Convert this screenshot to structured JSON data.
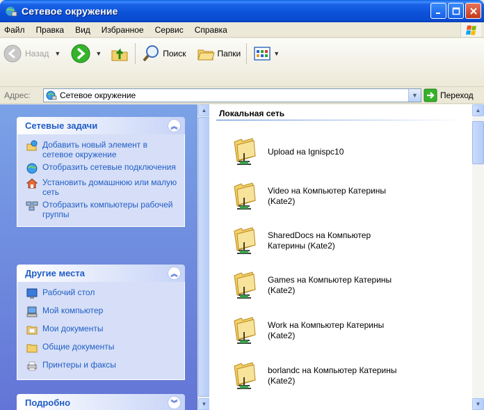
{
  "window": {
    "title": "Сетевое окружение"
  },
  "menu": {
    "items": [
      "Файл",
      "Правка",
      "Вид",
      "Избранное",
      "Сервис",
      "Справка"
    ]
  },
  "toolbar": {
    "back_label": "Назад",
    "search_label": "Поиск",
    "folders_label": "Папки"
  },
  "address": {
    "label": "Адрес:",
    "value": "Сетевое окружение",
    "go_label": "Переход"
  },
  "tasks_panel": {
    "title": "Сетевые задачи",
    "items": [
      "Добавить новый элемент в сетевое окружение",
      "Отобразить сетевые подключения",
      "Установить домашнюю или малую сеть",
      "Отобразить компьютеры рабочей группы"
    ]
  },
  "places_panel": {
    "title": "Другие места",
    "items": [
      "Рабочий стол",
      "Мой компьютер",
      "Мои документы",
      "Общие документы",
      "Принтеры и факсы"
    ]
  },
  "details_panel": {
    "title": "Подробно"
  },
  "content": {
    "group_title": "Локальная сеть",
    "items": [
      "Upload на Ignispc10",
      "Video на Компьютер Катерины (Kate2)",
      "SharedDocs на Компьютер Катерины (Kate2)",
      "Games на Компьютер Катерины (Kate2)",
      "Work на Компьютер Катерины (Kate2)",
      "borlandc на Компьютер Катерины (Kate2)"
    ]
  },
  "colors": {
    "title_bar": "#0b51d8",
    "task_link": "#215dc6",
    "task_pane": "#7ba2e7"
  }
}
